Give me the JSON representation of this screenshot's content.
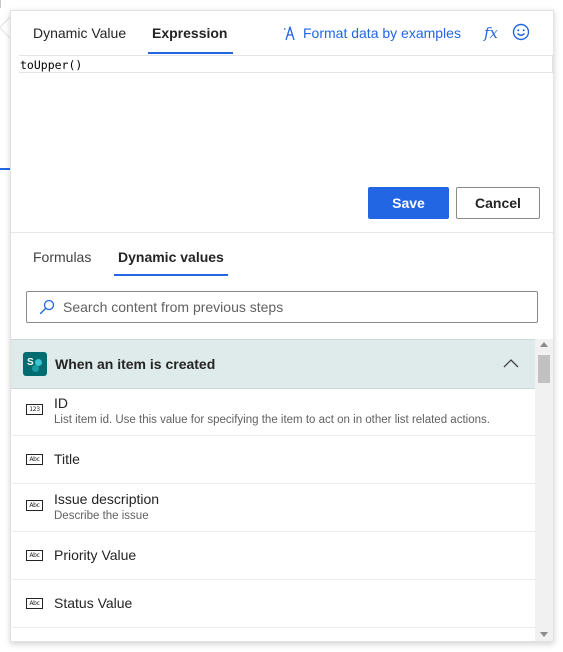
{
  "tabs": {
    "dynamic_value": "Dynamic Value",
    "expression": "Expression",
    "active": "Expression"
  },
  "toolbar": {
    "format_data_label": "Format data by examples",
    "fx_label": "fx",
    "fx_icon": "function-icon",
    "feedback_icon": "smiley-icon"
  },
  "editor": {
    "value": "toUpper()"
  },
  "actions": {
    "save_label": "Save",
    "cancel_label": "Cancel"
  },
  "subtabs": {
    "formulas": "Formulas",
    "dynamic_values": "Dynamic values",
    "active": "Dynamic values"
  },
  "search": {
    "placeholder": "Search content from previous steps",
    "value": ""
  },
  "section": {
    "title": "When an item is created",
    "icon": "sharepoint-icon",
    "expanded": true,
    "items": [
      {
        "name": "ID",
        "type_icon": "123",
        "description": "List item id. Use this value for specifying the item to act on in other list related actions."
      },
      {
        "name": "Title",
        "type_icon": "Abc",
        "description": ""
      },
      {
        "name": "Issue description",
        "type_icon": "Abc",
        "description": "Describe the issue"
      },
      {
        "name": "Priority Value",
        "type_icon": "Abc",
        "description": ""
      },
      {
        "name": "Status Value",
        "type_icon": "Abc",
        "description": ""
      }
    ]
  },
  "colors": {
    "accent": "#2266e3",
    "section_bg": "#dfeaea",
    "sharepoint": "#036c70"
  }
}
